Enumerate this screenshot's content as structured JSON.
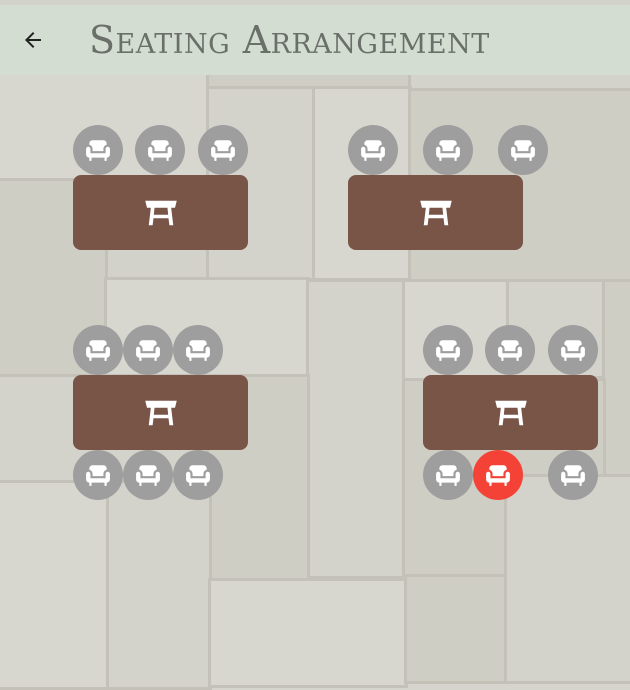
{
  "app_bar": {
    "title": "Seating Arrangement",
    "background": "#d3ddd1",
    "back_icon": "arrow-left-icon"
  },
  "colors": {
    "table": "#795548",
    "chair_free": "#9e9e9e",
    "chair_selected": "#f44336",
    "icon": "#ffffff"
  },
  "tables": [
    {
      "name": "table-1",
      "icon": "table-icon",
      "chairs_top": [
        {
          "state": "free"
        },
        {
          "state": "free"
        },
        {
          "state": "free"
        }
      ],
      "chairs_bottom": []
    },
    {
      "name": "table-2",
      "icon": "table-icon",
      "chairs_top": [
        {
          "state": "free"
        },
        {
          "state": "free"
        },
        {
          "state": "free"
        }
      ],
      "chairs_bottom": []
    },
    {
      "name": "table-3",
      "icon": "table-icon",
      "chairs_top": [
        {
          "state": "free"
        },
        {
          "state": "free"
        },
        {
          "state": "free"
        }
      ],
      "chairs_bottom": [
        {
          "state": "free"
        },
        {
          "state": "free"
        },
        {
          "state": "free"
        }
      ]
    },
    {
      "name": "table-4",
      "icon": "table-icon",
      "chairs_top": [
        {
          "state": "free"
        },
        {
          "state": "free"
        },
        {
          "state": "free"
        }
      ],
      "chairs_bottom": [
        {
          "state": "free"
        },
        {
          "state": "selected"
        },
        {
          "state": "free"
        }
      ]
    }
  ]
}
